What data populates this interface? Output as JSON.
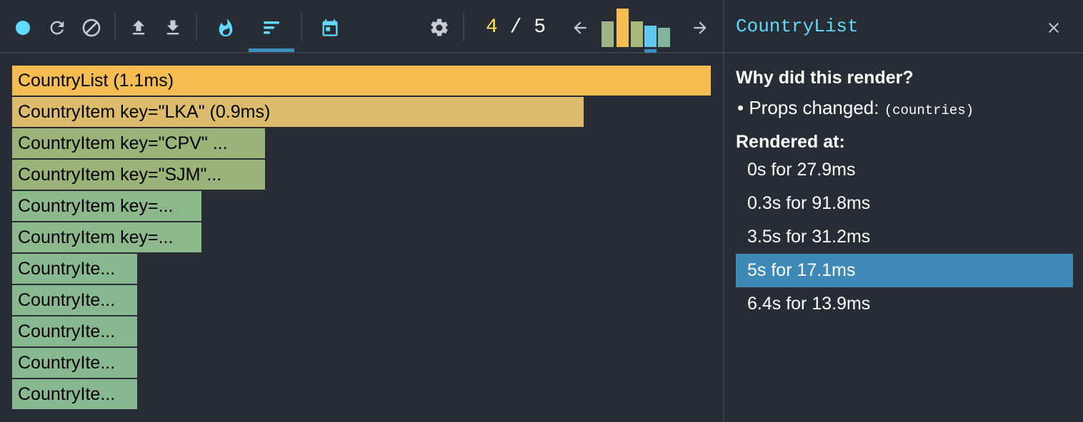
{
  "toolbar": {
    "icons": [
      "record-icon",
      "reload-icon",
      "clear-icon",
      "upload-icon",
      "download-icon",
      "flamegraph-icon",
      "ranked-icon",
      "timeline-icon",
      "settings-icon",
      "prev-arrow-icon",
      "next-arrow-icon"
    ],
    "active_tab": "ranked",
    "commit_current": "4",
    "commit_separator": "/",
    "commit_total": "5",
    "commit_bars": [
      {
        "level": 0.67,
        "color": "#9eb587"
      },
      {
        "level": 1.0,
        "color": "#f5bc52"
      },
      {
        "level": 0.67,
        "color": "#a8b87a"
      },
      {
        "level": 0.55,
        "color": "#61c8f0"
      },
      {
        "level": 0.5,
        "color": "#80b69e"
      }
    ],
    "colors": {
      "record": "#61dafb",
      "flame": "#61dafb",
      "accent": "#3b8fc0",
      "current": "#fce456"
    }
  },
  "flame_rows": [
    {
      "label": "CountryList (1.1ms)",
      "color": "#f5bc52"
    },
    {
      "label": "CountryItem key=\"LKA\" (0.9ms)",
      "color": "#dcbc6c"
    },
    {
      "label": "CountryItem key=\"CPV\" ...",
      "color": "#9ab379"
    },
    {
      "label": "CountryItem key=\"SJM\"...",
      "color": "#9ab379"
    },
    {
      "label": "CountryItem key=...",
      "color": "#8db88c"
    },
    {
      "label": "CountryItem key=...",
      "color": "#8db88c"
    },
    {
      "label": "CountryIte...",
      "color": "#88b890"
    },
    {
      "label": "CountryIte...",
      "color": "#88b890"
    },
    {
      "label": "CountryIte...",
      "color": "#88b890"
    },
    {
      "label": "CountryIte...",
      "color": "#88b890"
    },
    {
      "label": "CountryIte...",
      "color": "#88b890"
    }
  ],
  "sidebar": {
    "title": "CountryList",
    "why_heading": "Why did this render?",
    "bullet": "•",
    "props_changed_label": "Props changed:",
    "props_changed_value": "(countries)",
    "rendered_heading": "Rendered at:",
    "commits": [
      {
        "label": "0s for 27.9ms",
        "selected": false
      },
      {
        "label": "0.3s for 91.8ms",
        "selected": false
      },
      {
        "label": "3.5s for 31.2ms",
        "selected": false
      },
      {
        "label": "5s for 17.1ms",
        "selected": true
      },
      {
        "label": "6.4s for 13.9ms",
        "selected": false
      }
    ]
  }
}
